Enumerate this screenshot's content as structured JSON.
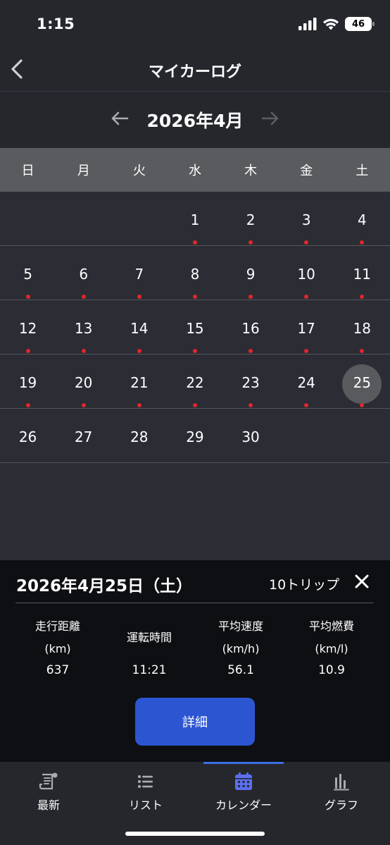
{
  "status_bar": {
    "time": "1:15",
    "battery": "46"
  },
  "nav": {
    "title": "マイカーログ"
  },
  "calendar": {
    "month_title": "2026年4月",
    "weekdays": [
      "日",
      "月",
      "火",
      "水",
      "木",
      "金",
      "土"
    ],
    "weeks": [
      [
        {
          "day": ""
        },
        {
          "day": ""
        },
        {
          "day": ""
        },
        {
          "day": "1",
          "has_log": true
        },
        {
          "day": "2",
          "has_log": true
        },
        {
          "day": "3",
          "has_log": true
        },
        {
          "day": "4",
          "has_log": true
        }
      ],
      [
        {
          "day": "5",
          "has_log": true
        },
        {
          "day": "6",
          "has_log": true
        },
        {
          "day": "7",
          "has_log": true
        },
        {
          "day": "8",
          "has_log": true
        },
        {
          "day": "9",
          "has_log": true
        },
        {
          "day": "10",
          "has_log": true
        },
        {
          "day": "11",
          "has_log": true
        }
      ],
      [
        {
          "day": "12",
          "has_log": true
        },
        {
          "day": "13",
          "has_log": true
        },
        {
          "day": "14",
          "has_log": true
        },
        {
          "day": "15",
          "has_log": true
        },
        {
          "day": "16",
          "has_log": true
        },
        {
          "day": "17",
          "has_log": true
        },
        {
          "day": "18",
          "has_log": true
        }
      ],
      [
        {
          "day": "19",
          "has_log": true
        },
        {
          "day": "20",
          "has_log": true
        },
        {
          "day": "21",
          "has_log": true
        },
        {
          "day": "22",
          "has_log": true
        },
        {
          "day": "23",
          "has_log": true
        },
        {
          "day": "24",
          "has_log": true
        },
        {
          "day": "25",
          "has_log": true,
          "selected": true
        }
      ],
      [
        {
          "day": "26"
        },
        {
          "day": "27"
        },
        {
          "day": "28"
        },
        {
          "day": "29"
        },
        {
          "day": "30"
        },
        {
          "day": ""
        },
        {
          "day": ""
        }
      ]
    ]
  },
  "detail": {
    "date": "2026年4月25日（土）",
    "trips": "10トリップ",
    "stats": {
      "distance": {
        "label_line1": "走行距離",
        "label_line2": "(km)",
        "value": "637"
      },
      "drive_time": {
        "label": "運転時間",
        "value": "11:21"
      },
      "avg_speed": {
        "label_line1": "平均速度",
        "label_line2": "(km/h)",
        "value": "56.1"
      },
      "avg_fuel": {
        "label_line1": "平均燃費",
        "label_line2": "(km/l)",
        "value": "10.9"
      }
    },
    "button_label": "詳細"
  },
  "tabs": [
    {
      "label": "最新",
      "icon": "news-icon"
    },
    {
      "label": "リスト",
      "icon": "list-icon"
    },
    {
      "label": "カレンダー",
      "icon": "calendar-icon",
      "active": true
    },
    {
      "label": "グラフ",
      "icon": "graph-icon"
    }
  ],
  "colors": {
    "background": "#2b2c34",
    "header": "#26272d",
    "weekday_bar": "#5a5b5f",
    "log_dot": "#e0262d",
    "selected_ring": "#595a5e",
    "panel": "#0e0f12",
    "primary_button": "#2c55d1",
    "tab_active": "#5b6ff0"
  }
}
